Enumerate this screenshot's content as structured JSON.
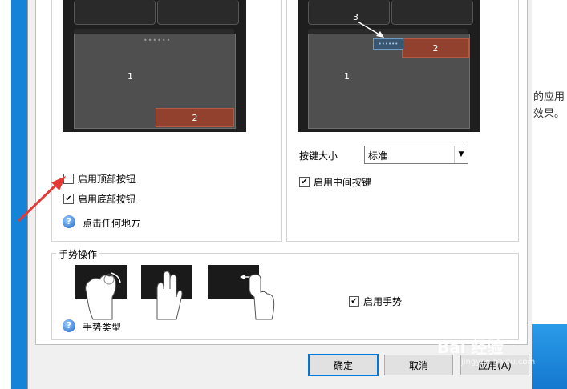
{
  "background": {
    "text_line1": "的应用",
    "text_line2": "效果。"
  },
  "left_diagram": {
    "zone1": "1",
    "zone2": "2"
  },
  "right_diagram": {
    "zone1": "1",
    "zone2": "2",
    "zone3": "3"
  },
  "left_group": {
    "enable_top_buttons": {
      "label": "启用顶部按钮",
      "checked": false
    },
    "enable_bottom_buttons": {
      "label": "启用底部按钮",
      "checked": true
    },
    "help_link": "点击任何地方"
  },
  "right_group": {
    "button_size_label": "按键大小",
    "button_size_value": "标准",
    "enable_middle_button": {
      "label": "启用中间按键",
      "checked": true
    }
  },
  "gestures": {
    "title": "手势操作",
    "enable_gestures": {
      "label": "启用手势",
      "checked": true
    },
    "help_link": "手势类型"
  },
  "buttons": {
    "ok": "确定",
    "cancel": "取消",
    "apply": "应用(A)"
  },
  "watermark": {
    "logo": "Bai 经验",
    "url": "jingyan.baidu.com"
  },
  "colors": {
    "accent": "#0078d7",
    "zone_red": "#93412f",
    "annotation_arrow": "#e53935"
  }
}
